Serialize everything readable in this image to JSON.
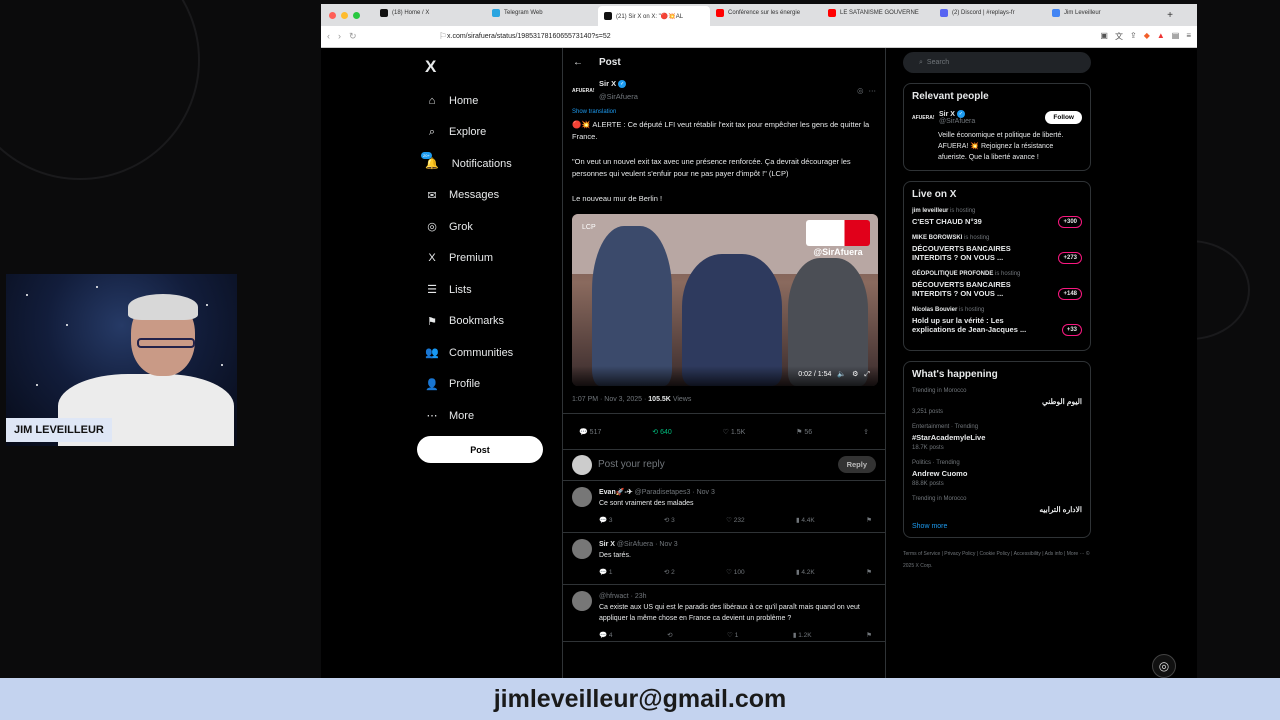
{
  "browser": {
    "tabs": [
      {
        "label": "(18) Home / X",
        "color": "#111"
      },
      {
        "label": "Telegram Web",
        "color": "#2aa5e0"
      },
      {
        "label": "(21) Sir X on X: \"🔴💥AL",
        "color": "#111",
        "active": true
      },
      {
        "label": "Conférence sur les énergie",
        "color": "#ff0000"
      },
      {
        "label": "LE SATANISME GOUVERNE",
        "color": "#ff0000"
      },
      {
        "label": "(2) Discord | #replays-fr",
        "color": "#5865f2"
      },
      {
        "label": "Jim Leveilleur",
        "color": "#4285f4"
      }
    ],
    "url": "x.com/sirafuera/status/1985317816065573140?s=52",
    "new_tab_label": "+"
  },
  "sidebar": {
    "logo": "X",
    "items": [
      {
        "label": "Home",
        "icon": "⌂",
        "name": "home"
      },
      {
        "label": "Explore",
        "icon": "⌕",
        "name": "explore"
      },
      {
        "label": "Notifications",
        "icon": "🔔",
        "name": "notifications",
        "badge": "20+"
      },
      {
        "label": "Messages",
        "icon": "✉",
        "name": "messages"
      },
      {
        "label": "Grok",
        "icon": "◎",
        "name": "grok"
      },
      {
        "label": "Premium",
        "icon": "X",
        "name": "premium"
      },
      {
        "label": "Lists",
        "icon": "☰",
        "name": "lists"
      },
      {
        "label": "Bookmarks",
        "icon": "⚑",
        "name": "bookmarks"
      },
      {
        "label": "Communities",
        "icon": "👥",
        "name": "communities"
      },
      {
        "label": "Profile",
        "icon": "👤",
        "name": "profile"
      },
      {
        "label": "More",
        "icon": "⋯",
        "name": "more"
      }
    ],
    "post_label": "Post"
  },
  "post": {
    "header": "Post",
    "author": {
      "name": "Sir X",
      "handle": "@SirAfuera",
      "avatar_text": "AFUERA!"
    },
    "show_translation": "Show translation",
    "text_1": "🔴💥 ALERTE : Ce député LFI veut rétablir l'exit tax pour empêcher les gens de quitter la France.",
    "text_2": "\"On veut un nouvel exit tax avec une présence renforcée. Ça devrait décourager les personnes qui veulent s'enfuir pour ne pas payer d'impôt !\" (LCP)",
    "text_3": "Le nouveau mur de Berlin !",
    "video": {
      "time": "0:02 / 1:54",
      "watermark": "@SirAfuera",
      "channel": "LCP"
    },
    "timestamp": "1:07 PM · Nov 3, 2025 ·",
    "views_count": "105.5K",
    "views_label": "Views",
    "stats": {
      "replies": "517",
      "reposts": "640",
      "likes": "1.5K",
      "bookmarks": "56"
    },
    "reply_placeholder": "Post your reply",
    "reply_button": "Reply"
  },
  "replies": [
    {
      "name": "Evan🚀-✈",
      "handle": "@Paradisetapes3 · Nov 3",
      "text": "Ce sont vraiment des malades",
      "stats": [
        "3",
        "3",
        "232",
        "4.4K"
      ]
    },
    {
      "name": "Sir X",
      "handle": "@SirAfuera · Nov 3",
      "text": "Des tarés.",
      "stats": [
        "1",
        "2",
        "100",
        "4.2K"
      ]
    },
    {
      "name": "",
      "handle": "@hfrwact · 23h",
      "text": "Ca existe aux US qui est le paradis des libéraux à ce qu'il paraît mais quand on veut appliquer la même chose en France ca devient un problème ?",
      "stats": [
        "4",
        "",
        "1",
        "1.2K"
      ]
    }
  ],
  "right": {
    "search_placeholder": "Search",
    "relevant_title": "Relevant people",
    "relevant": {
      "name": "Sir X",
      "handle": "@SirAfuera",
      "follow": "Follow",
      "bio": "Veille économique et politique de liberté. AFUERA! 💥 Rejoignez la résistance afueriste. Que la liberté avance !"
    },
    "live_title": "Live on X",
    "live": [
      {
        "host": "jim leveilleur",
        "status": "is hosting",
        "title": "C'EST CHAUD N°39",
        "count": "+300"
      },
      {
        "host": "MIKE BOROWSKI",
        "status": "is hosting",
        "title": "DÉCOUVERTS BANCAIRES INTERDITS ? ON VOUS ...",
        "count": "+273"
      },
      {
        "host": "GÉOPOLITIQUE PROFONDE",
        "status": "is hosting",
        "title": "DÉCOUVERTS BANCAIRES INTERDITS ? ON VOUS ...",
        "count": "+148"
      },
      {
        "host": "Nicolas Bouvier",
        "status": "is hosting",
        "title": "Hold up sur la vérité : Les explications de Jean-Jacques ...",
        "count": "+33"
      }
    ],
    "happening_title": "What's happening",
    "trends": [
      {
        "context": "Trending in Morocco",
        "title": "اليوم الوطني",
        "posts": "3,251 posts"
      },
      {
        "context": "Entertainment · Trending",
        "title": "#StarAcademyleLive",
        "posts": "18.7K posts"
      },
      {
        "context": "Politics · Trending",
        "title": "Andrew Cuomo",
        "posts": "88.8K posts"
      },
      {
        "context": "Trending in Morocco",
        "title": "الاداره الترابيه",
        "posts": ""
      }
    ],
    "show_more": "Show more",
    "footer": "Terms of Service | Privacy Policy | Cookie Policy | Accessibility | Ads info | More ··· © 2025 X Corp."
  },
  "overlay": {
    "cam_label": "JIM LEVEILLEUR",
    "email": "jimleveilleur@gmail.com"
  }
}
